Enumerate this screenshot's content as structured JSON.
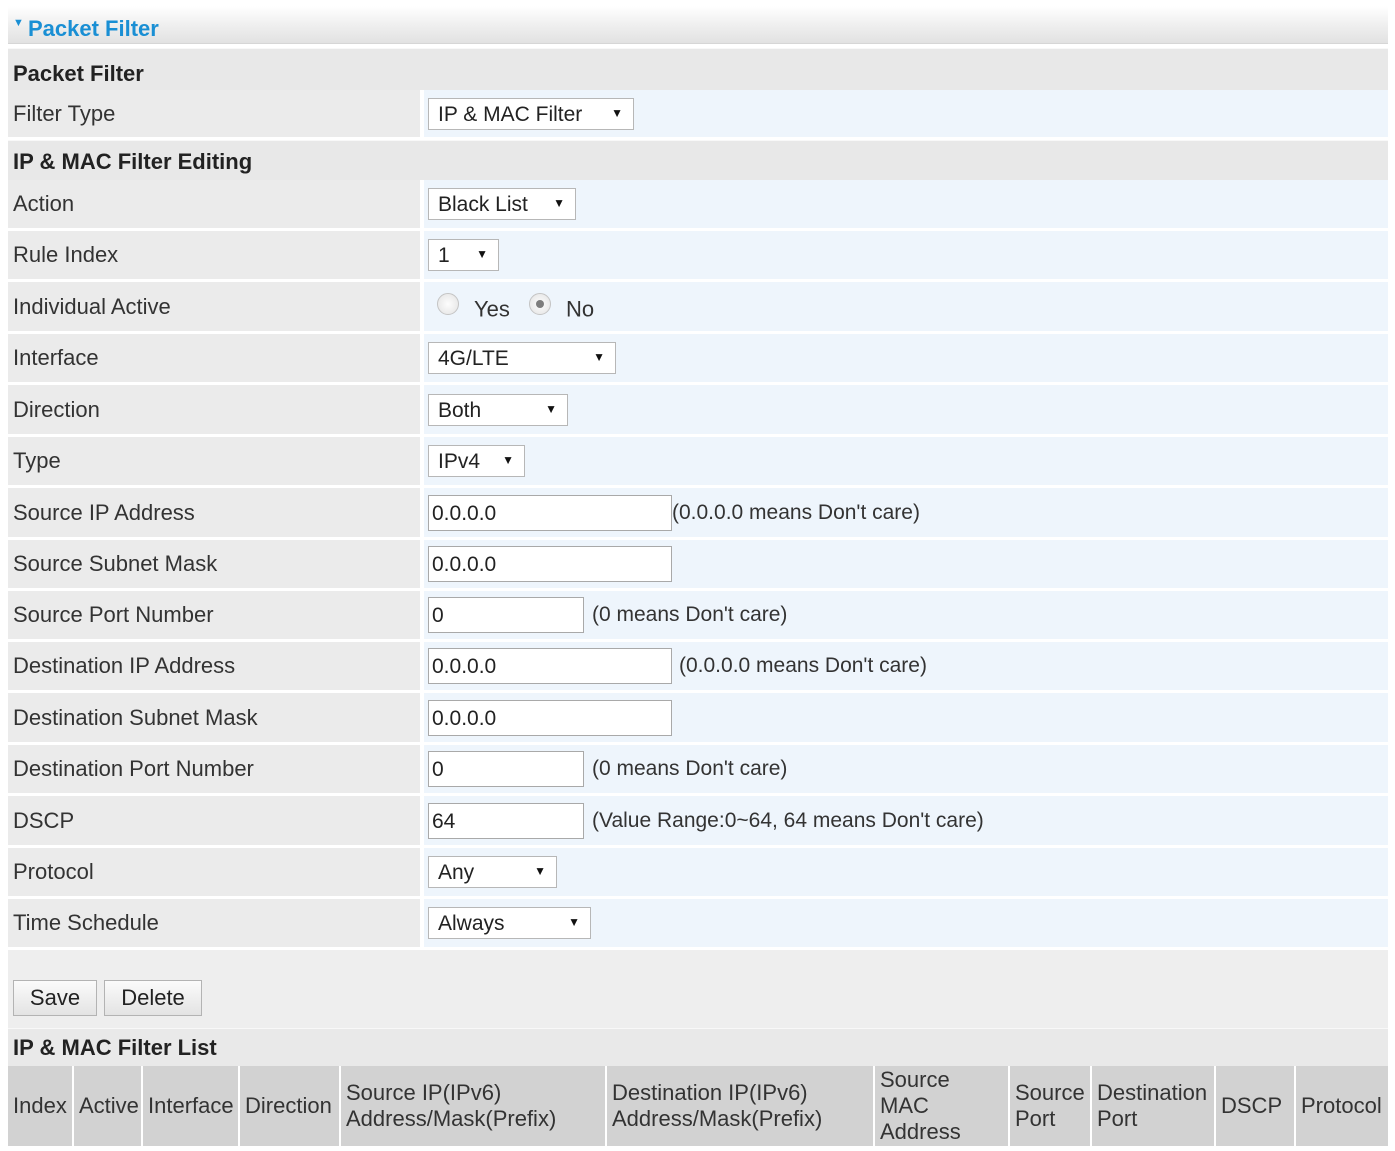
{
  "panel": {
    "title": "Packet Filter"
  },
  "sections": {
    "packet_filter": "Packet Filter",
    "editing": "IP & MAC Filter Editing",
    "list": "IP & MAC Filter List"
  },
  "filter_type": {
    "label": "Filter Type",
    "value": "IP & MAC Filter"
  },
  "action": {
    "label": "Action",
    "value": "Black List"
  },
  "rule_index": {
    "label": "Rule Index",
    "value": "1"
  },
  "individual_active": {
    "label": "Individual Active",
    "yes_label": "Yes",
    "no_label": "No",
    "selected": "No"
  },
  "interface": {
    "label": "Interface",
    "value": "4G/LTE"
  },
  "direction": {
    "label": "Direction",
    "value": "Both"
  },
  "type": {
    "label": "Type",
    "value": "IPv4"
  },
  "source_ip": {
    "label": "Source IP Address",
    "value": "0.0.0.0",
    "hint": "(0.0.0.0 means Don't care)"
  },
  "source_mask": {
    "label": "Source Subnet Mask",
    "value": "0.0.0.0"
  },
  "source_port": {
    "label": "Source Port Number",
    "value": "0",
    "hint": "(0 means Don't care)"
  },
  "dest_ip": {
    "label": "Destination IP Address",
    "value": "0.0.0.0",
    "hint": "(0.0.0.0 means Don't care)"
  },
  "dest_mask": {
    "label": "Destination Subnet Mask",
    "value": "0.0.0.0"
  },
  "dest_port": {
    "label": "Destination Port Number",
    "value": "0",
    "hint": "(0 means Don't care)"
  },
  "dscp": {
    "label": "DSCP",
    "value": "64",
    "hint": "(Value Range:0~64, 64 means Don't care)"
  },
  "protocol": {
    "label": "Protocol",
    "value": "Any"
  },
  "time_schedule": {
    "label": "Time Schedule",
    "value": "Always"
  },
  "buttons": {
    "save": "Save",
    "delete": "Delete"
  },
  "table": {
    "headers": [
      [
        "Index"
      ],
      [
        "Active"
      ],
      [
        "Interface"
      ],
      [
        "Direction"
      ],
      [
        "Source IP(IPv6)",
        "Address/Mask(Prefix)"
      ],
      [
        "Destination IP(IPv6)",
        "Address/Mask(Prefix)"
      ],
      [
        "Source",
        "MAC",
        "Address"
      ],
      [
        "Source",
        "Port"
      ],
      [
        "Destination",
        "Port"
      ],
      [
        "DSCP"
      ],
      [
        "Protocol"
      ]
    ]
  },
  "icons": {
    "panel_toggle": "triangle-down-icon",
    "dropdown": "caret-down-icon"
  },
  "colors": {
    "title": "#1a8fd4",
    "section_bg": "#e8e8e8",
    "label_bg": "#ebebeb",
    "value_bg": "#eef5fc",
    "header_bg": "#d2d2d2"
  }
}
